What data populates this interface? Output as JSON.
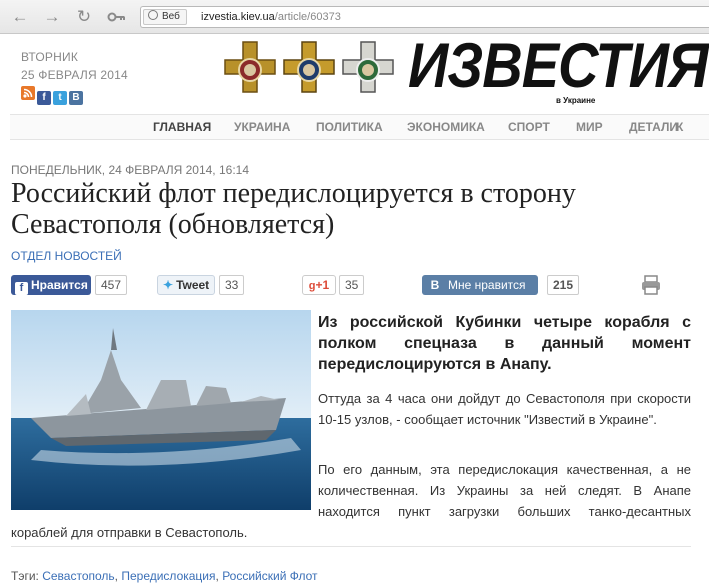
{
  "browser": {
    "back_icon": "back-arrow-icon",
    "forward_icon": "forward-arrow-icon",
    "reload_icon": "reload-icon",
    "key_icon": "key-icon",
    "search_chip": "Веб",
    "url_domain": "izvestia.kiev.ua",
    "url_path": "/article/60373"
  },
  "header": {
    "weekday": "ВТОРНИК",
    "date": "25 ФЕВРАЛЯ 2014",
    "social": [
      {
        "icon": "rss-icon",
        "glyph": "",
        "color": "#e8782a"
      },
      {
        "icon": "facebook-icon",
        "glyph": "f",
        "color": "#3b5998"
      },
      {
        "icon": "twitter-icon",
        "glyph": "t",
        "color": "#3aa1dd"
      },
      {
        "icon": "vkontakte-icon",
        "glyph": "B",
        "color": "#4b73a0"
      }
    ],
    "logo": "ИЗВЕСТИЯ",
    "logo_sub": "в Украине"
  },
  "nav": {
    "items": [
      "ГЛАВНАЯ",
      "УКРАИНА",
      "ПОЛИТИКА",
      "ЭКОНОМИКА",
      "СПОРТ",
      "МИР",
      "ДЕТАЛИ",
      "К"
    ]
  },
  "article": {
    "date": "ПОНЕДЕЛЬНИК, 24 ФЕВРАЛЯ 2014, 16:14",
    "title": "Российский флот передислоцируется в сторону Севастополя (обновляется)",
    "author": "ОТДЕЛ НОВОСТЕЙ",
    "lead": "Из российской Кубинки четыре корабля с полком спецназа в данный момент передислоцируются в Анапу.",
    "p1": "Оттуда за 4 часа они дойдут до Севастополя при скорости 10-15 узлов, - сообщает источник \"Известий в Украине\".",
    "p2": "По его данным, эта передислокация качественная, а не количественная. Из Украины за ней следят. В Анапе находится пункт загрузки больших танко-десантных кораблей для отправки в Севастополь."
  },
  "share": {
    "fb_label": "Нравится",
    "fb_count": "457",
    "tw_label": "Tweet",
    "tw_count": "33",
    "gp_label": "+1",
    "gp_count": "35",
    "vk_label": "Мне нравится",
    "vk_count": "215",
    "print_icon": "printer-icon"
  },
  "tags": {
    "label": "Тэги:",
    "items": [
      "Севастополь",
      "Передислокация",
      "Российский Флот"
    ]
  },
  "colors": {
    "link": "#3b6fb6",
    "facebook": "#3b5998",
    "vk": "#5b7fa6",
    "gplus": "#dd4b39"
  }
}
